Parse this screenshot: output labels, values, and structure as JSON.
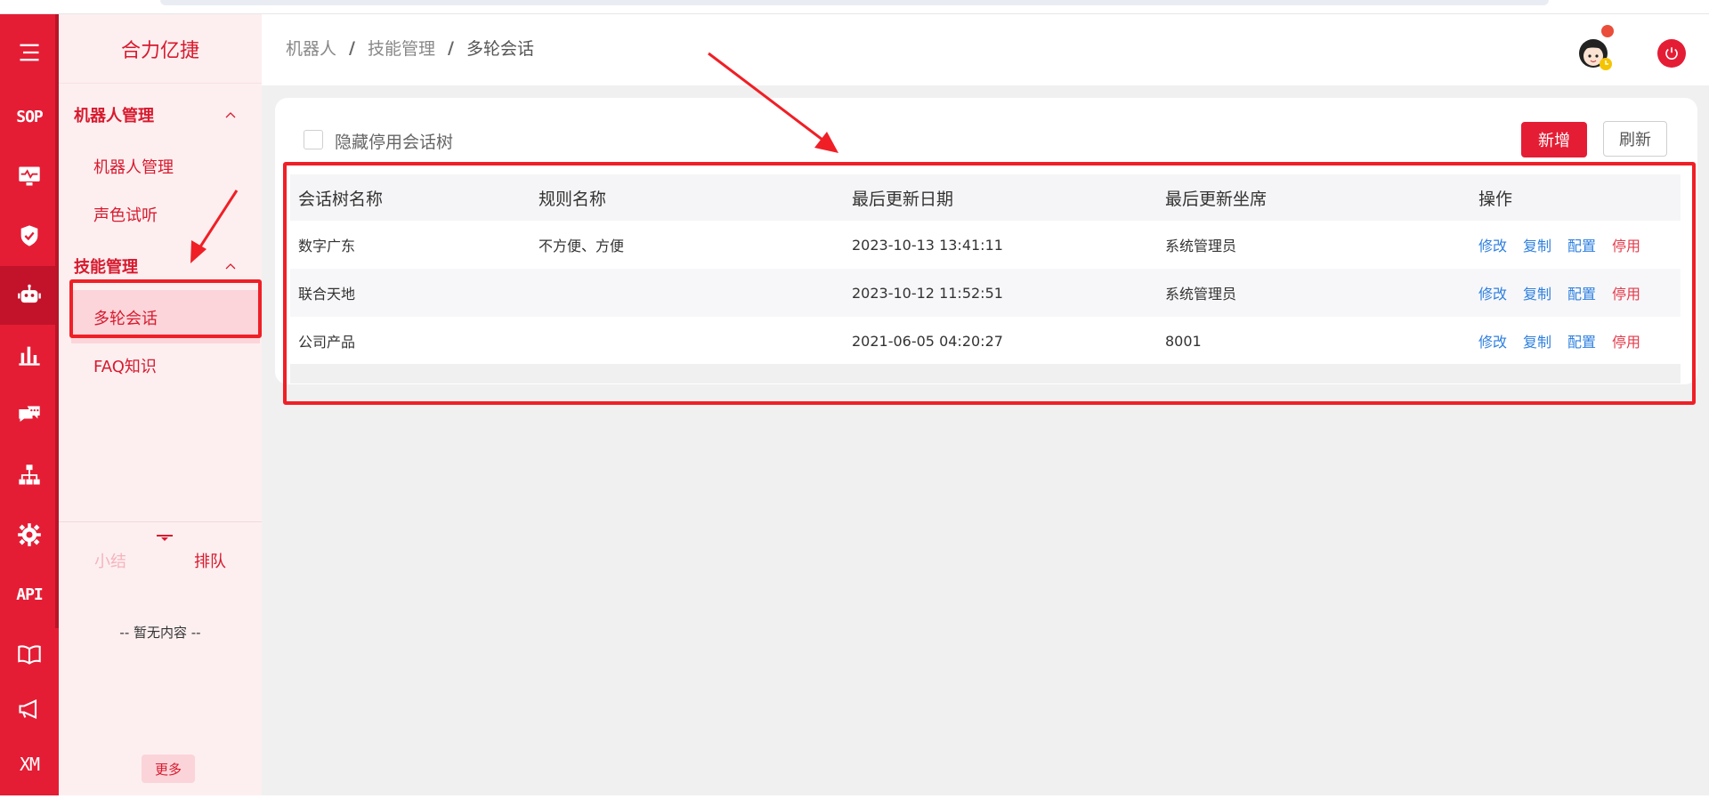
{
  "app": {
    "brand": "合力亿捷"
  },
  "rail": {
    "items": [
      {
        "id": "menu",
        "icon": "hamburger-menu-icon"
      },
      {
        "id": "sop",
        "label": "SOP"
      },
      {
        "id": "monitor",
        "icon": "monitor-pulse-icon"
      },
      {
        "id": "shield",
        "icon": "shield-check-icon"
      },
      {
        "id": "robot",
        "icon": "robot-icon",
        "active": true
      },
      {
        "id": "chart",
        "icon": "bar-chart-icon"
      },
      {
        "id": "chat",
        "icon": "chat-bubbles-icon"
      },
      {
        "id": "org",
        "icon": "org-tree-icon"
      },
      {
        "id": "settings",
        "icon": "gear-icon"
      },
      {
        "id": "api",
        "label": "API"
      },
      {
        "id": "book",
        "icon": "book-icon"
      },
      {
        "id": "announce",
        "icon": "megaphone-icon"
      },
      {
        "id": "xm",
        "label": "XM"
      }
    ]
  },
  "subnav": {
    "group1_title": "机器人管理",
    "group1_items": [
      "机器人管理",
      "声色试听"
    ],
    "group2_title": "技能管理",
    "group2_items": [
      "多轮会话",
      "FAQ知识"
    ],
    "tab_summary": "小结",
    "tab_queue": "排队",
    "empty_text": "-- 暂无内容 --",
    "more_label": "更多"
  },
  "breadcrumb": {
    "items": [
      "机器人",
      "技能管理",
      "多轮会话"
    ],
    "separator": "/"
  },
  "toolbar": {
    "hide_disabled_label": "隐藏停用会话树",
    "add_label": "新增",
    "refresh_label": "刷新"
  },
  "table": {
    "headers": [
      "会话树名称",
      "规则名称",
      "最后更新日期",
      "最后更新坐席",
      "操作"
    ],
    "rows": [
      {
        "name": "数字广东",
        "rule": "不方便、方便",
        "date": "2023-10-13 13:41:11",
        "agent": "系统管理员"
      },
      {
        "name": "联合天地",
        "rule": "",
        "date": "2023-10-12 11:52:51",
        "agent": "系统管理员"
      },
      {
        "name": "公司产品",
        "rule": "",
        "date": "2021-06-05 04:20:27",
        "agent": "8001"
      }
    ],
    "ops": {
      "edit": "修改",
      "copy": "复制",
      "config": "配置",
      "disable": "停用"
    }
  },
  "colors": {
    "brand": "#e41d35",
    "link": "#2f80e0",
    "annotation": "#f01f26"
  }
}
